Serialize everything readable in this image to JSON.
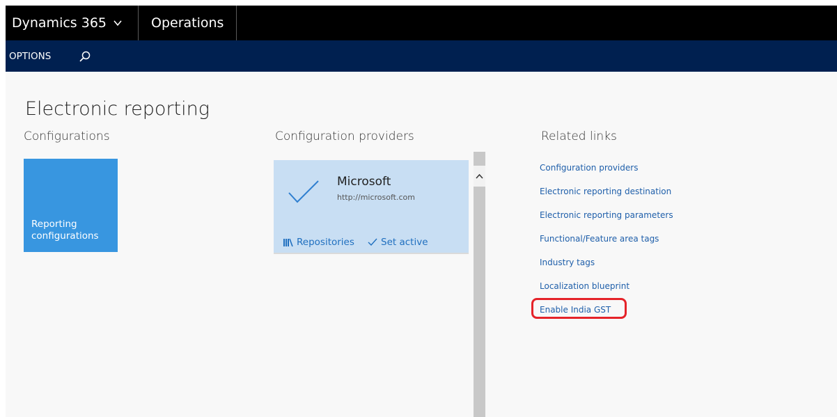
{
  "topbar": {
    "app_name": "Dynamics 365",
    "module_name": "Operations"
  },
  "actionbar": {
    "options_label": "OPTIONS",
    "search_icon": "search-icon"
  },
  "page": {
    "title": "Electronic reporting"
  },
  "configurations": {
    "heading": "Configurations",
    "tile_label": "Reporting configurations",
    "tile_color": "#3896e0"
  },
  "providers": {
    "heading": "Configuration providers",
    "card": {
      "name": "Microsoft",
      "url": "http://microsoft.com",
      "active_icon": "checkmark-icon",
      "repositories_label": "Repositories",
      "set_active_label": "Set active",
      "background": "#c8def3"
    }
  },
  "related_links": {
    "heading": "Related links",
    "items": [
      "Configuration providers",
      "Electronic reporting destination",
      "Electronic reporting parameters",
      "Functional/Feature area tags",
      "Industry tags",
      "Localization blueprint",
      "Enable India GST"
    ],
    "highlighted_item": "Enable India GST",
    "highlight_color": "#e52329"
  },
  "colors": {
    "topbar": "#000000",
    "actionbar": "#002050",
    "link": "#1f5faa"
  }
}
